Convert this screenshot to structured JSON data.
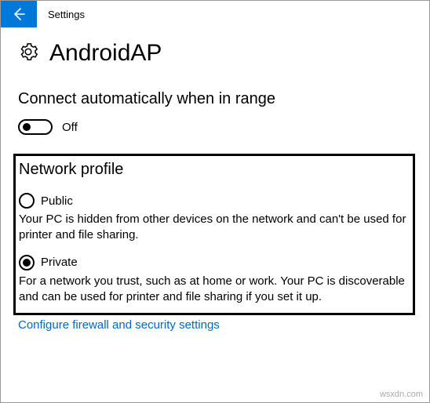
{
  "titlebar": {
    "title": "Settings"
  },
  "page": {
    "icon": "gear-icon",
    "heading": "AndroidAP"
  },
  "connect": {
    "section_title": "Connect automatically when in range",
    "toggle_state": false,
    "toggle_label": "Off"
  },
  "profile": {
    "heading": "Network profile",
    "options": [
      {
        "label": "Public",
        "selected": false,
        "description": "Your PC is hidden from other devices on the network and can't be used for printer and file sharing."
      },
      {
        "label": "Private",
        "selected": true,
        "description": "For a network you trust, such as at home or work. Your PC is discoverable and can be used for printer and file sharing if you set it up."
      }
    ]
  },
  "link": {
    "text": "Configure firewall and security settings"
  },
  "watermark": "wsxdn.com"
}
